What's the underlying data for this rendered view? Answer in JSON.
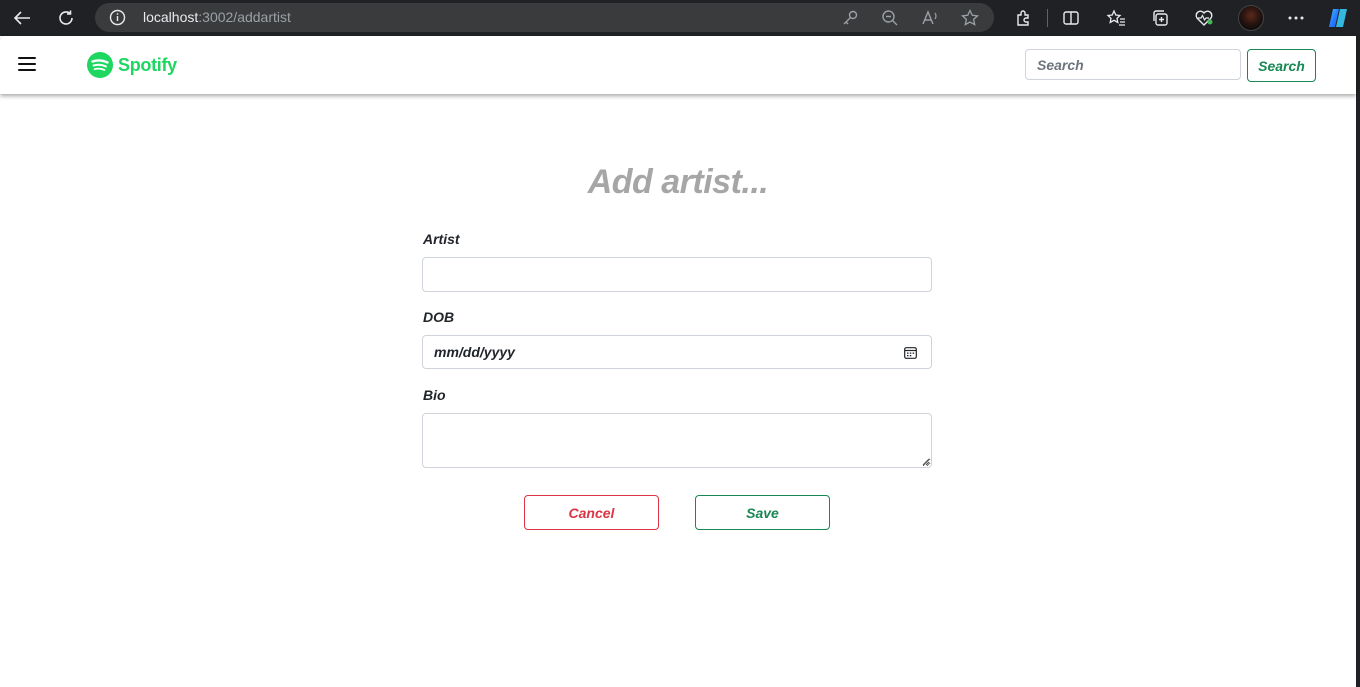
{
  "browser": {
    "url_host": "localhost",
    "url_path": ":3002/addartist"
  },
  "navbar": {
    "brand": "Spotify",
    "search_placeholder": "Search",
    "search_button": "Search"
  },
  "form": {
    "title": "Add artist...",
    "artist_label": "Artist",
    "artist_value": "",
    "dob_label": "DOB",
    "dob_placeholder": "mm/dd/yyyy",
    "bio_label": "Bio",
    "bio_value": "",
    "cancel_label": "Cancel",
    "save_label": "Save"
  },
  "colors": {
    "brand_green": "#1ed760",
    "success": "#198754",
    "danger": "#dc3545",
    "title_gray": "#a6a6a6"
  }
}
